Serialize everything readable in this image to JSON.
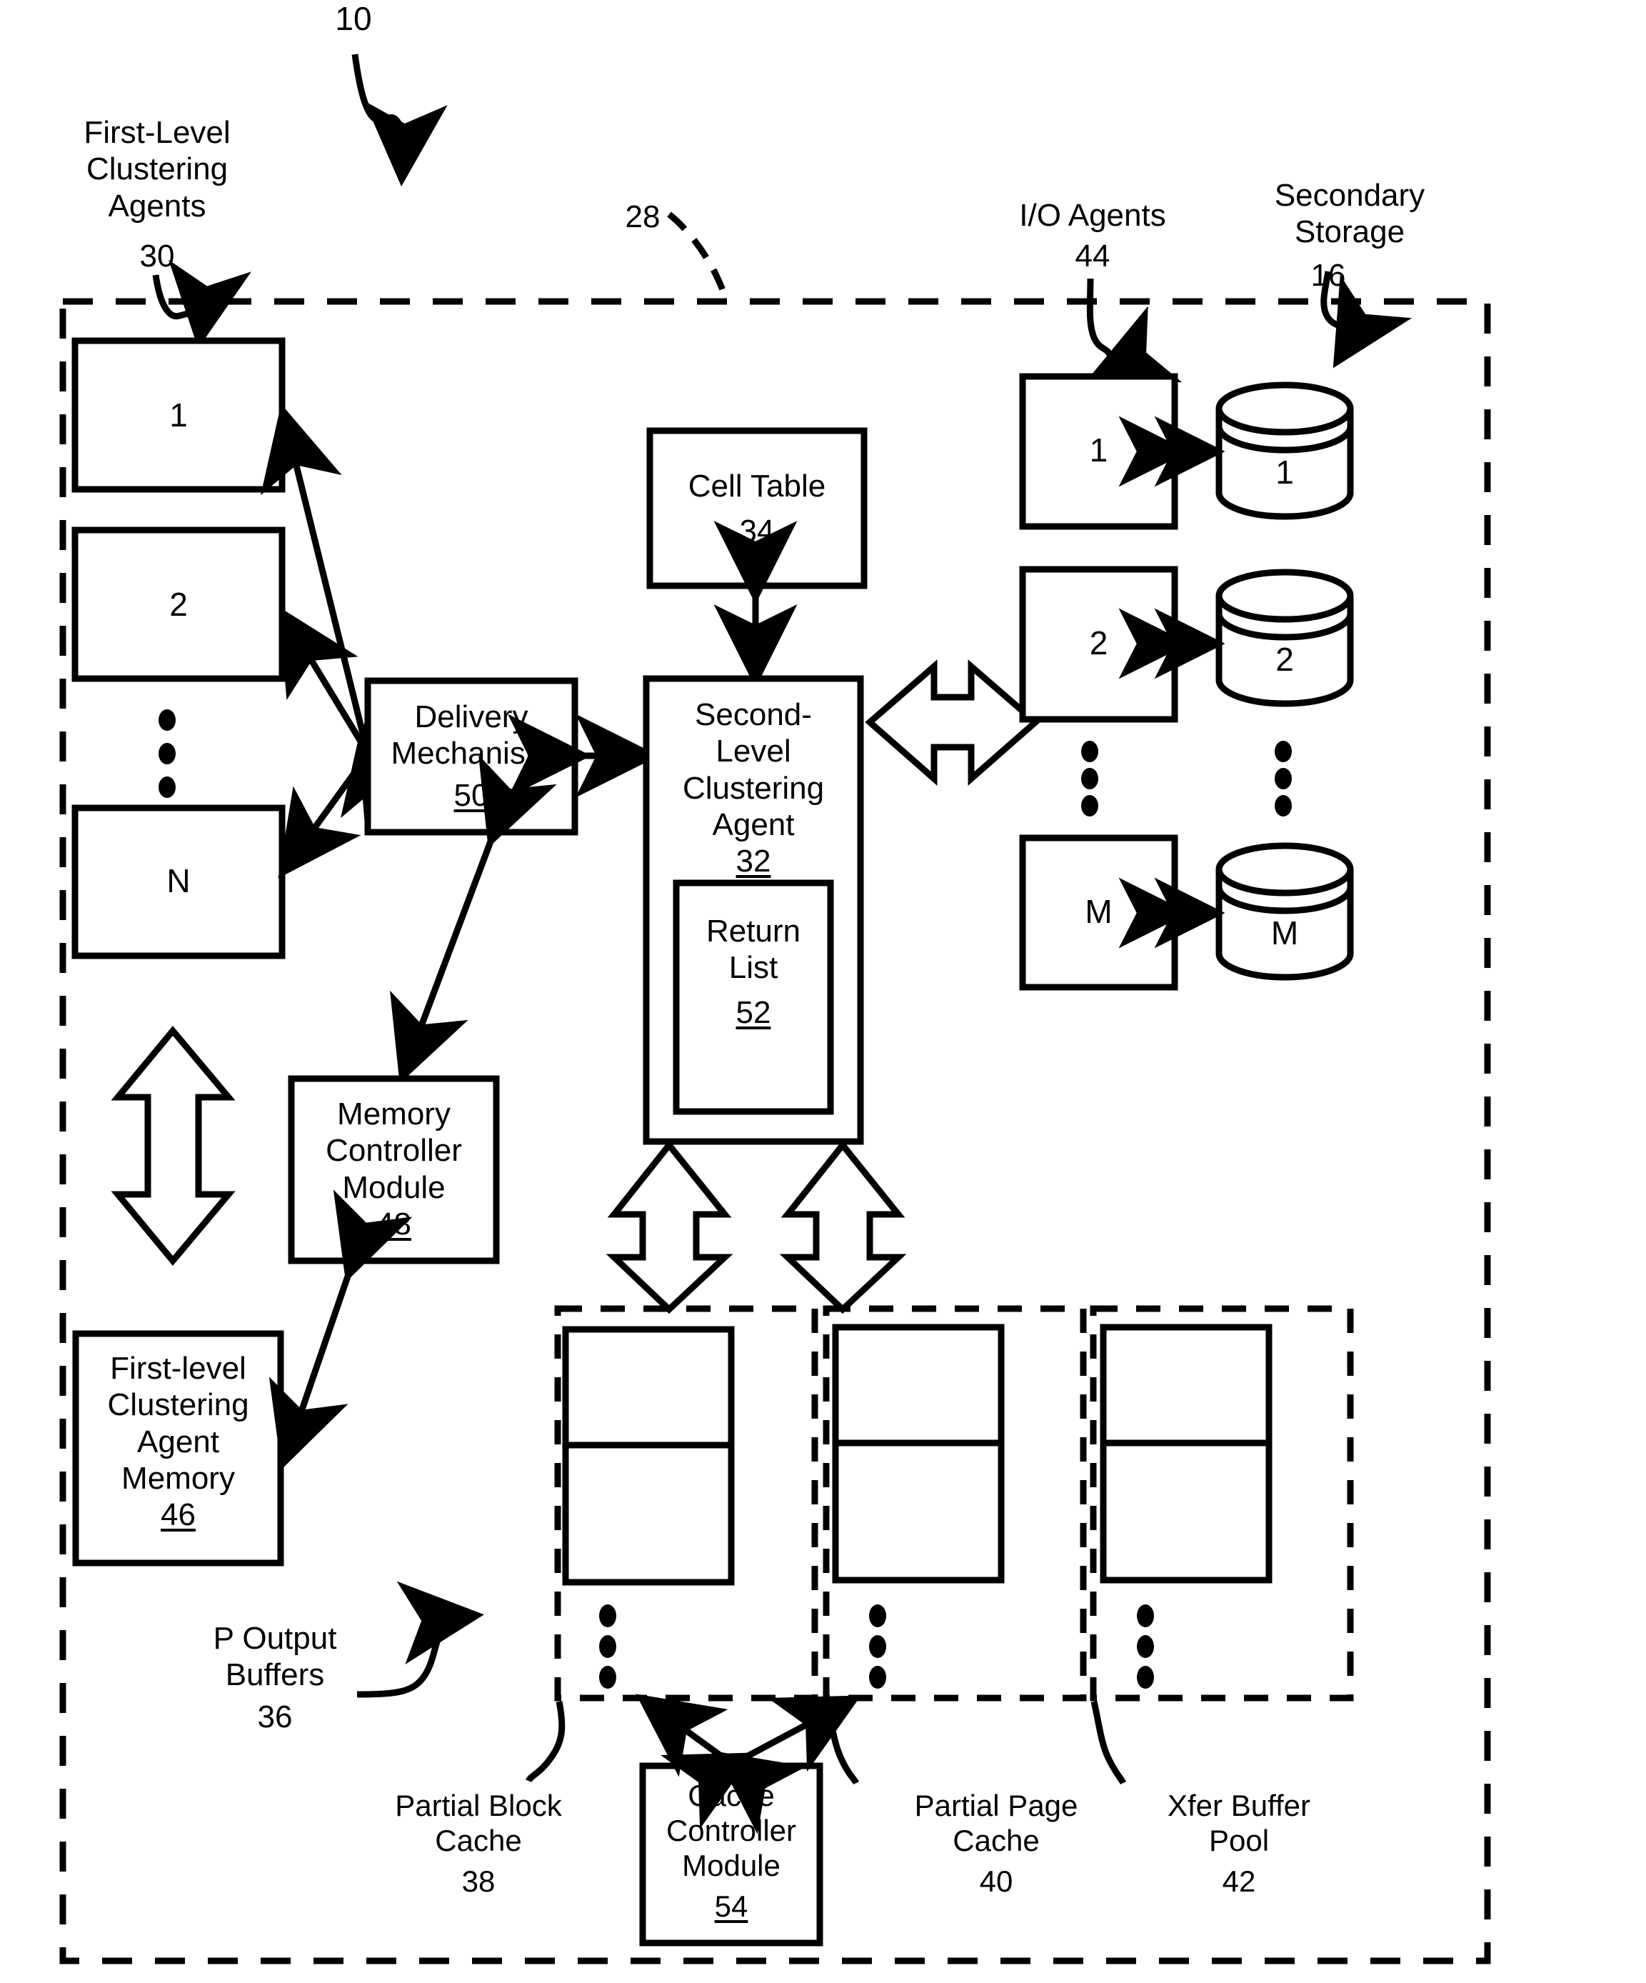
{
  "figure": {
    "system_ref": "10",
    "boundary_ref": "28"
  },
  "left_group": {
    "title": "First-Level\nClustering\nAgents",
    "ref": "30",
    "agents": [
      "1",
      "2",
      "N"
    ],
    "ellipsis": "⋮"
  },
  "io_group": {
    "title": "I/O Agents",
    "ref": "44",
    "agents": [
      "1",
      "2",
      "M"
    ]
  },
  "storage_group": {
    "title": "Secondary\nStorage",
    "ref": "16",
    "disks": [
      "1",
      "2",
      "M"
    ]
  },
  "cell_table": {
    "label": "Cell Table",
    "ref": "34"
  },
  "second_level_agent": {
    "label": "Second-\nLevel\nClustering\nAgent",
    "ref": "32",
    "return_list": {
      "label": "Return\nList",
      "ref": "52"
    }
  },
  "delivery_mechanism": {
    "label": "Delivery\nMechanism",
    "ref": "50"
  },
  "memory_controller": {
    "label": "Memory\nController\nModule",
    "ref": "48"
  },
  "agent_memory": {
    "label": "First-level\nClustering\nAgent\nMemory",
    "ref": "46"
  },
  "output_buffers": {
    "label": "P Output\nBuffers",
    "ref": "36"
  },
  "partial_block_cache": {
    "label": "Partial Block\nCache",
    "ref": "38"
  },
  "cache_controller": {
    "label": "Cache\nController\nModule",
    "ref": "54"
  },
  "partial_page_cache": {
    "label": "Partial Page\nCache",
    "ref": "40"
  },
  "xfer_buffer_pool": {
    "label": "Xfer Buffer\nPool",
    "ref": "42"
  },
  "colors": {
    "stroke": "#000000",
    "background": "#ffffff"
  }
}
